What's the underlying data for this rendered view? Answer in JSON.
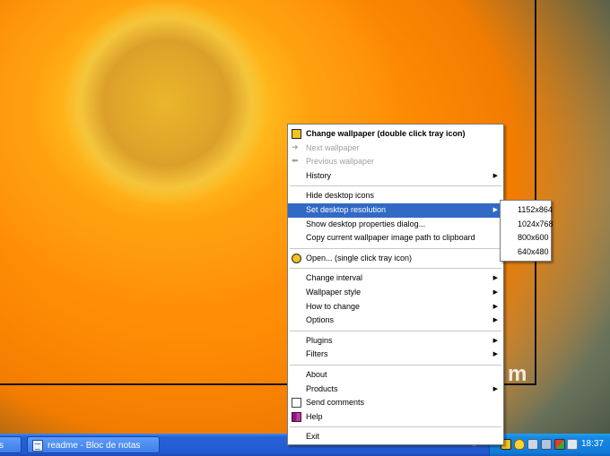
{
  "menu": {
    "items": [
      {
        "label": "Change wallpaper  (double click tray icon)",
        "bold": true,
        "icon": "wallpaper-app-icon"
      },
      {
        "label": "Next wallpaper",
        "disabled": true,
        "icon": "arrow-right-icon"
      },
      {
        "label": "Previous wallpaper",
        "disabled": true,
        "icon": "arrow-left-icon"
      },
      {
        "label": "History",
        "submenu": true
      },
      {
        "sep": true
      },
      {
        "label": "Hide desktop icons"
      },
      {
        "label": "Set desktop resolution",
        "submenu": true,
        "highlighted": true
      },
      {
        "label": "Show desktop properties dialog..."
      },
      {
        "label": "Copy current wallpaper image path to clipboard"
      },
      {
        "sep": true
      },
      {
        "label": "Open...  (single click tray icon)",
        "icon": "open-app-icon"
      },
      {
        "sep": true
      },
      {
        "label": "Change interval",
        "submenu": true
      },
      {
        "label": "Wallpaper style",
        "submenu": true
      },
      {
        "label": "How to change",
        "submenu": true
      },
      {
        "label": "Options",
        "submenu": true
      },
      {
        "sep": true
      },
      {
        "label": "Plugins",
        "submenu": true
      },
      {
        "label": "Filters",
        "submenu": true
      },
      {
        "sep": true
      },
      {
        "label": "About"
      },
      {
        "label": "Products",
        "submenu": true
      },
      {
        "label": "Send comments",
        "icon": "envelope-icon"
      },
      {
        "label": "Help",
        "icon": "help-book-icon"
      },
      {
        "sep": true
      },
      {
        "label": "Exit"
      }
    ]
  },
  "submenu": {
    "items": [
      "1152x864",
      "1024x768",
      "800x600",
      "640x480"
    ]
  },
  "taskbar": {
    "left_button_label": "s",
    "notepad_button_label": "readme - Bloc de notas",
    "tray_arrow": "«",
    "clock": "18:37"
  },
  "desktop": {
    "watermark": "m"
  },
  "colors": {
    "menu_highlight": "#316ac5",
    "taskbar_blue": "#2459d0",
    "tray_blue": "#117ad8",
    "petal_orange": "#ff8c05"
  }
}
